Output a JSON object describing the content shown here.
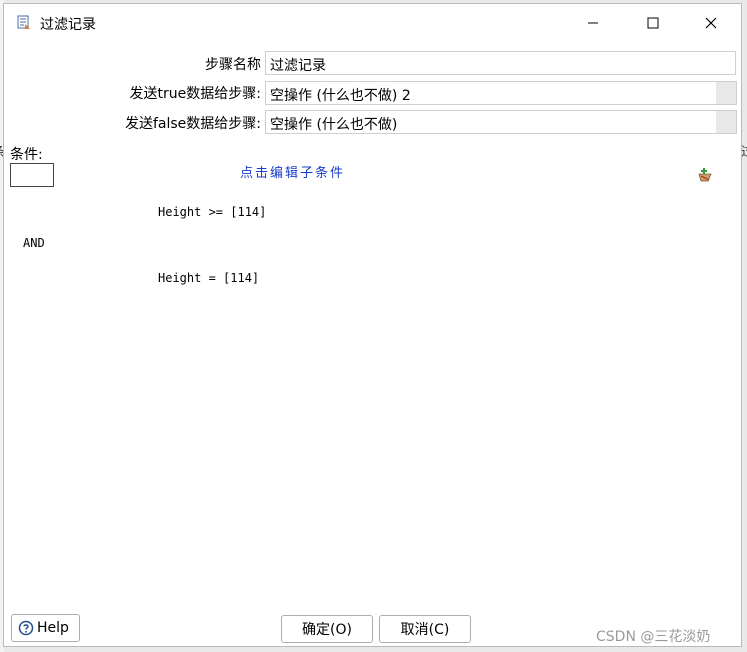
{
  "window": {
    "title": "过滤记录",
    "minimize_icon": "minimize-icon",
    "maximize_icon": "maximize-icon",
    "close_icon": "close-icon"
  },
  "background": {
    "left_edge_char": "条",
    "right_edge_char": "过"
  },
  "form": {
    "step_name_label": "步骤名称",
    "step_name_value": "过滤记录",
    "true_step_label": "发送true数据给步骤:",
    "true_step_value": "空操作 (什么也不做) 2",
    "false_step_label": "发送false数据给步骤:",
    "false_step_value": "空操作 (什么也不做)"
  },
  "conditions": {
    "label": "条件:",
    "edit_link": "点击编辑子条件",
    "add_icon": "add-condition-icon",
    "rows": [
      {
        "text": "Height >= [114]"
      },
      {
        "operator": "AND"
      },
      {
        "text": "Height = [114]"
      }
    ]
  },
  "buttons": {
    "help": "Help",
    "ok": "确定(O)",
    "cancel": "取消(C)"
  },
  "watermark": "CSDN @三花淡奶",
  "colors": {
    "link": "#1a3ccb",
    "dialog_bg": "#ffffff"
  }
}
